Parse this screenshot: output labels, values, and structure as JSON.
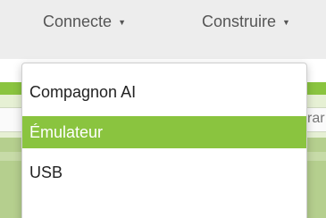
{
  "menubar": {
    "items": [
      {
        "label": "Connecte",
        "caret": "▼"
      },
      {
        "label": "Construire",
        "caret": "▼"
      }
    ]
  },
  "dropdown": {
    "items": [
      {
        "label": "Compagnon AI"
      },
      {
        "label": "Émulateur",
        "highlighted": true
      },
      {
        "label": "USB"
      }
    ]
  },
  "background": {
    "fragment_text": "rar"
  },
  "colors": {
    "accent": "#8ac43f",
    "menubar_bg": "#ededed"
  }
}
